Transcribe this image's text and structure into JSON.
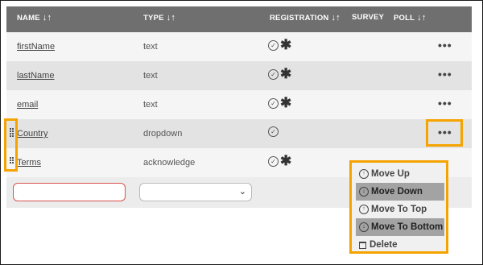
{
  "table": {
    "headers": {
      "name": "NAME",
      "type": "TYPE",
      "registration": "REGISTRATION",
      "survey": "SURVEY",
      "poll": "POLL",
      "sort_glyph": "↓↑"
    },
    "rows": [
      {
        "name": "firstName",
        "type": "text",
        "required": true
      },
      {
        "name": "lastName",
        "type": "text",
        "required": true
      },
      {
        "name": "email",
        "type": "text",
        "required": true
      },
      {
        "name": "Country",
        "type": "dropdown",
        "required": false
      },
      {
        "name": "Terms",
        "type": "acknowledge",
        "required": true
      }
    ],
    "more_glyph": "•••",
    "check_glyph": "✓",
    "required_glyph": "✱"
  },
  "new_row": {
    "name_value": "",
    "type_value": "",
    "select_chevron": "⌄"
  },
  "context_menu": {
    "items": [
      {
        "label": "Move Up",
        "icon": "arrow-up-circle-icon",
        "glyph": "↑",
        "selected": false
      },
      {
        "label": "Move Down",
        "icon": "arrow-down-circle-icon",
        "glyph": "↓",
        "selected": true
      },
      {
        "label": "Move To Top",
        "icon": "arrow-up-circle-icon",
        "glyph": "↑",
        "selected": false
      },
      {
        "label": "Move To Bottom",
        "icon": "arrow-down-circle-icon",
        "glyph": "↓",
        "selected": true
      },
      {
        "label": "Delete",
        "icon": "trash-icon",
        "glyph": "",
        "selected": false
      }
    ]
  },
  "colors": {
    "header_bg": "#6f6f6f",
    "highlight": "#f5a300",
    "input_error_border": "#d9534f",
    "selected_item_bg": "#a3a3a3"
  }
}
